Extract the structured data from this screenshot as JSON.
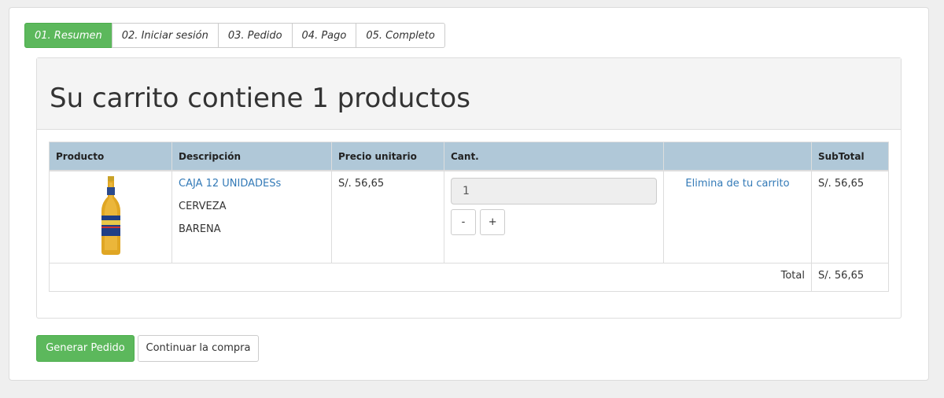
{
  "steps": [
    {
      "label": "01. Resumen"
    },
    {
      "label": "02. Iniciar sesión"
    },
    {
      "label": "03. Pedido"
    },
    {
      "label": "04. Pago"
    },
    {
      "label": "05. Completo"
    }
  ],
  "cart": {
    "title": "Su carrito contiene 1 productos",
    "headers": {
      "product": "Producto",
      "description": "Descripción",
      "unit_price": "Precio unitario",
      "qty": "Cant.",
      "action": "",
      "subtotal": "SubTotal"
    },
    "items": [
      {
        "name": "CAJA 12 UNIDADESs",
        "line1": "CERVEZA",
        "line2": "BARENA",
        "unit_price": "S/. 56,65",
        "qty": "1",
        "minus": "-",
        "plus": "+",
        "remove": "Elimina de tu carrito",
        "subtotal": "S/. 56,65"
      }
    ],
    "total_label": "Total",
    "total_value": "S/. 56,65"
  },
  "actions": {
    "checkout": "Generar Pedido",
    "continue": "Continuar la compra"
  },
  "colors": {
    "accent": "#5cb85c",
    "header_bg": "#b0c8d8",
    "link": "#337ab7"
  }
}
